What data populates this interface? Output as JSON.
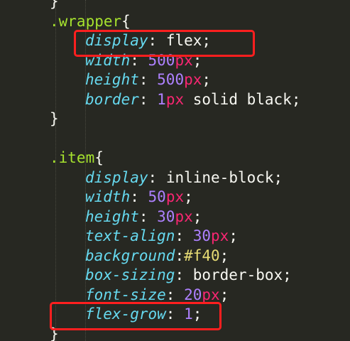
{
  "editor": {
    "lines": [
      {
        "indent": 1,
        "tokens": [
          {
            "t": "}",
            "c": "punct"
          }
        ]
      },
      {
        "indent": 1,
        "tokens": [
          {
            "t": ".wrapper",
            "c": "sel"
          },
          {
            "t": "{",
            "c": "punct"
          }
        ]
      },
      {
        "indent": 2,
        "tokens": [
          {
            "t": "display",
            "c": "prop"
          },
          {
            "t": ": ",
            "c": "punct"
          },
          {
            "t": "flex",
            "c": "val"
          },
          {
            "t": ";",
            "c": "punct"
          }
        ]
      },
      {
        "indent": 2,
        "tokens": [
          {
            "t": "width",
            "c": "prop"
          },
          {
            "t": ": ",
            "c": "punct"
          },
          {
            "t": "500",
            "c": "num"
          },
          {
            "t": "px",
            "c": "unit"
          },
          {
            "t": ";",
            "c": "punct"
          }
        ]
      },
      {
        "indent": 2,
        "tokens": [
          {
            "t": "height",
            "c": "prop"
          },
          {
            "t": ": ",
            "c": "punct"
          },
          {
            "t": "500",
            "c": "num"
          },
          {
            "t": "px",
            "c": "unit"
          },
          {
            "t": ";",
            "c": "punct"
          }
        ]
      },
      {
        "indent": 2,
        "tokens": [
          {
            "t": "border",
            "c": "prop"
          },
          {
            "t": ": ",
            "c": "punct"
          },
          {
            "t": "1",
            "c": "num"
          },
          {
            "t": "px",
            "c": "unit"
          },
          {
            "t": " solid black;",
            "c": "val"
          }
        ]
      },
      {
        "indent": 1,
        "tokens": [
          {
            "t": "}",
            "c": "punct"
          }
        ]
      },
      {
        "indent": 0,
        "tokens": []
      },
      {
        "indent": 1,
        "tokens": [
          {
            "t": ".item",
            "c": "sel"
          },
          {
            "t": "{",
            "c": "punct"
          }
        ]
      },
      {
        "indent": 2,
        "tokens": [
          {
            "t": "display",
            "c": "prop"
          },
          {
            "t": ": ",
            "c": "punct"
          },
          {
            "t": "inline-block",
            "c": "val"
          },
          {
            "t": ";",
            "c": "punct"
          }
        ]
      },
      {
        "indent": 2,
        "tokens": [
          {
            "t": "width",
            "c": "prop"
          },
          {
            "t": ": ",
            "c": "punct"
          },
          {
            "t": "50",
            "c": "num"
          },
          {
            "t": "px",
            "c": "unit"
          },
          {
            "t": ";",
            "c": "punct"
          }
        ]
      },
      {
        "indent": 2,
        "tokens": [
          {
            "t": "height",
            "c": "prop"
          },
          {
            "t": ": ",
            "c": "punct"
          },
          {
            "t": "30",
            "c": "num"
          },
          {
            "t": "px",
            "c": "unit"
          },
          {
            "t": ";",
            "c": "punct"
          }
        ]
      },
      {
        "indent": 2,
        "tokens": [
          {
            "t": "text-align",
            "c": "prop"
          },
          {
            "t": ": ",
            "c": "punct"
          },
          {
            "t": "30",
            "c": "num"
          },
          {
            "t": "px",
            "c": "unit"
          },
          {
            "t": ";",
            "c": "punct"
          }
        ]
      },
      {
        "indent": 2,
        "tokens": [
          {
            "t": "background",
            "c": "prop"
          },
          {
            "t": ":",
            "c": "punct"
          },
          {
            "t": "#f40",
            "c": "hex"
          },
          {
            "t": ";",
            "c": "punct"
          }
        ]
      },
      {
        "indent": 2,
        "tokens": [
          {
            "t": "box-sizing",
            "c": "prop"
          },
          {
            "t": ": ",
            "c": "punct"
          },
          {
            "t": "border-box",
            "c": "val"
          },
          {
            "t": ";",
            "c": "punct"
          }
        ]
      },
      {
        "indent": 2,
        "tokens": [
          {
            "t": "font-size",
            "c": "prop"
          },
          {
            "t": ": ",
            "c": "punct"
          },
          {
            "t": "20",
            "c": "num"
          },
          {
            "t": "px",
            "c": "unit"
          },
          {
            "t": ";",
            "c": "punct"
          }
        ]
      },
      {
        "indent": 2,
        "tokens": [
          {
            "t": "flex-grow",
            "c": "prop"
          },
          {
            "t": ": ",
            "c": "punct"
          },
          {
            "t": "1",
            "c": "num"
          },
          {
            "t": ";",
            "c": "punct"
          }
        ]
      },
      {
        "indent": 1,
        "tokens": [
          {
            "t": "}",
            "c": "punct"
          }
        ]
      }
    ],
    "highlights": [
      {
        "line": 2,
        "label": "display: flex"
      },
      {
        "line": 16,
        "label": "flex-grow: 1"
      }
    ]
  },
  "colors": {
    "background": "#272822",
    "selector": "#a6e22e",
    "property": "#66d9ef",
    "number": "#ae81ff",
    "unit": "#f92672",
    "hex_value": "#e6db74",
    "text": "#f8f8f2",
    "annotation_box": "#ff1f1f"
  }
}
